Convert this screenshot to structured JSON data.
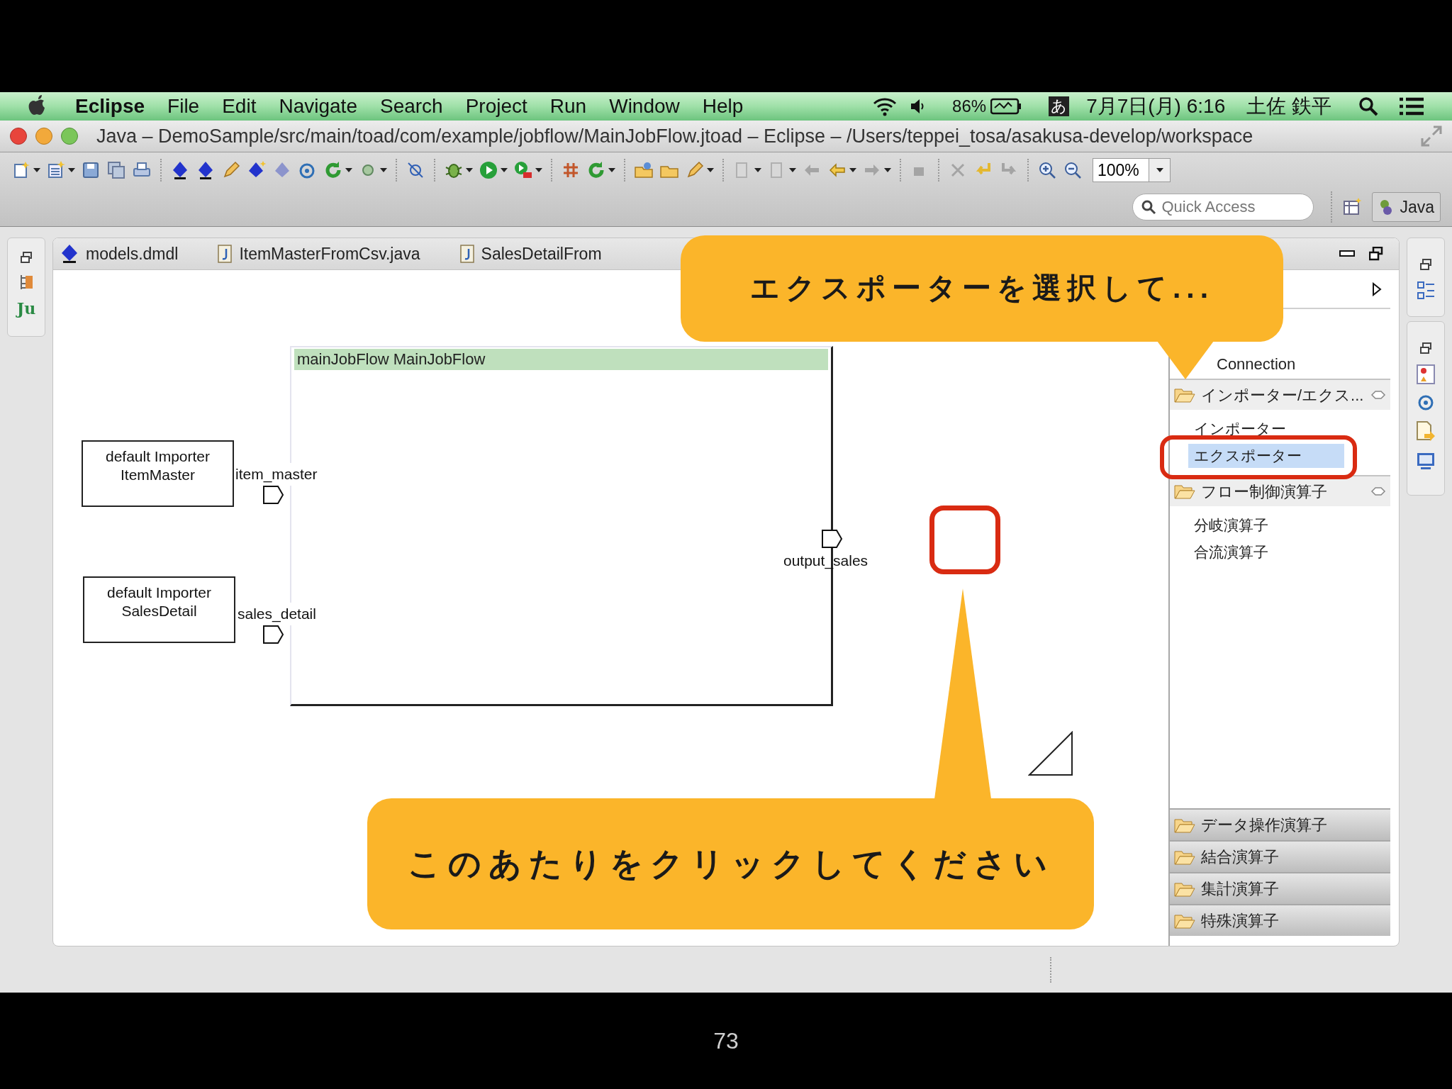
{
  "menu_bar": {
    "app": "Eclipse",
    "menus": [
      "File",
      "Edit",
      "Navigate",
      "Search",
      "Project",
      "Run",
      "Window",
      "Help"
    ],
    "battery": "86%",
    "input_mode": "あ",
    "clock": "7月7日(月) 6:16",
    "user": "土佐 鉄平"
  },
  "window": {
    "title": "Java – DemoSample/src/main/toad/com/example/jobflow/MainJobFlow.jtoad – Eclipse – /Users/teppei_tosa/asakusa-develop/workspace"
  },
  "toolbar": {
    "zoom": "100%",
    "quick_access": {
      "placeholder": "Quick Access"
    },
    "perspective": "Java"
  },
  "left_trim": {
    "badge": "Ju"
  },
  "editor_tabs": [
    {
      "label": "models.dmdl",
      "kind": "model"
    },
    {
      "label": "ItemMasterFromCsv.java",
      "kind": "java"
    },
    {
      "label": "SalesDetailFrom",
      "kind": "java"
    }
  ],
  "diagram": {
    "flow": {
      "title": "mainJobFlow MainJobFlow",
      "inputs": [
        "item_master",
        "sales_detail"
      ],
      "outputs": [
        "output_sales"
      ]
    },
    "importers": [
      {
        "lines": [
          "default Importer",
          "ItemMaster"
        ]
      },
      {
        "lines": [
          "default Importer",
          "SalesDetail"
        ]
      }
    ]
  },
  "palette": {
    "tools": [
      "Connection"
    ],
    "drawers": [
      {
        "label": "インポーター/エクス...",
        "expanded": true,
        "items": [
          {
            "label": "インポーター",
            "selected": false
          },
          {
            "label": "エクスポーター",
            "selected": true
          }
        ]
      },
      {
        "label": "フロー制御演算子",
        "expanded": true,
        "items": [
          {
            "label": "分岐演算子",
            "selected": false
          },
          {
            "label": "合流演算子",
            "selected": false
          }
        ]
      },
      {
        "label": "データ操作演算子",
        "expanded": false
      },
      {
        "label": "結合演算子",
        "expanded": false
      },
      {
        "label": "集計演算子",
        "expanded": false
      },
      {
        "label": "特殊演算子",
        "expanded": false
      }
    ]
  },
  "callouts": [
    {
      "text": "エクスポーターを選択して..."
    },
    {
      "text": "このあたりをクリックしてください"
    }
  ],
  "page_number": "73"
}
